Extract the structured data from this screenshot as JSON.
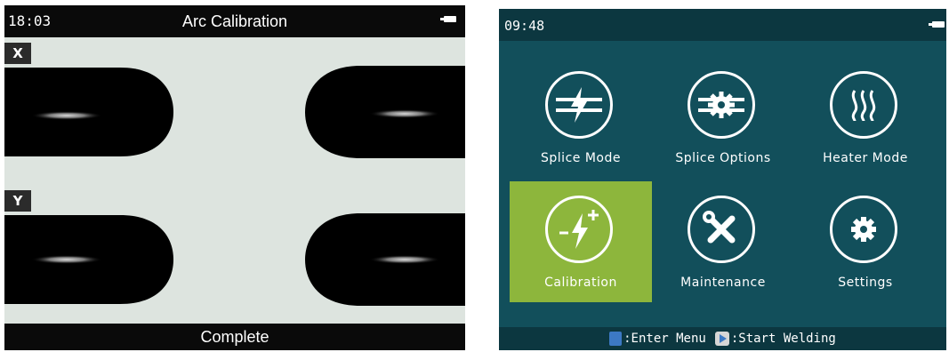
{
  "calibration_screen": {
    "time": "18:03",
    "title": "Arc Calibration",
    "view_x_label": "X",
    "view_y_label": "Y",
    "status": "Complete"
  },
  "menu_screen": {
    "time": "09:48",
    "items": [
      {
        "label": "Splice Mode",
        "icon": "splice-mode-icon",
        "selected": false
      },
      {
        "label": "Splice Options",
        "icon": "splice-options-icon",
        "selected": false
      },
      {
        "label": "Heater Mode",
        "icon": "heater-mode-icon",
        "selected": false
      },
      {
        "label": "Calibration",
        "icon": "calibration-icon",
        "selected": true
      },
      {
        "label": "Maintenance",
        "icon": "maintenance-icon",
        "selected": false
      },
      {
        "label": "Settings",
        "icon": "settings-icon",
        "selected": false
      }
    ],
    "hint_enter": ":Enter Menu",
    "hint_start": ":Start Welding"
  },
  "colors": {
    "menu_background": "#124f5b",
    "menu_bar": "#0c3740",
    "selected": "#8db63c",
    "calibration_background": "#dde4df"
  }
}
